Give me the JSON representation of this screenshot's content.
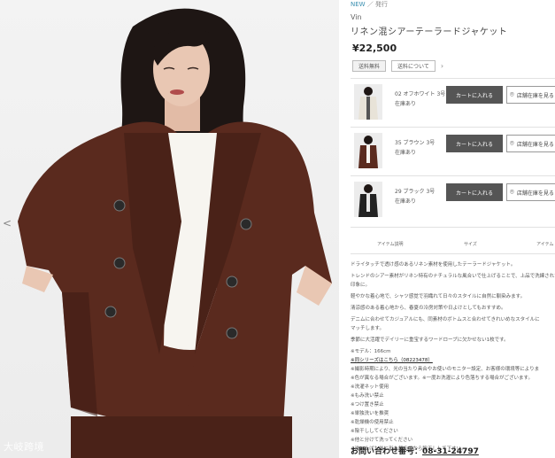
{
  "breadcrumb": {
    "new_label": "NEW",
    "rest": "／ 発行"
  },
  "product": {
    "brand": "Vin",
    "title": "リネン混シアーテーラードジャケット",
    "price": "¥22,500",
    "tags": [
      "送料無料",
      "送料について"
    ]
  },
  "variants": [
    {
      "color": "02 オフホワイト 3号",
      "stock": "在庫あり",
      "cart_label": "カートに入れる",
      "store_label": "店舗在庫を見る"
    },
    {
      "color": "35 ブラウン 3号",
      "stock": "在庫あり",
      "cart_label": "カートに入れる",
      "store_label": "店舗在庫を見る"
    },
    {
      "color": "29 ブラック 3号",
      "stock": "在庫あり",
      "cart_label": "カートに入れる",
      "store_label": "店舗在庫を見る"
    }
  ],
  "tabs": [
    "アイテム説明",
    "サイズ",
    "アイテム"
  ],
  "description": [
    "ドライタッチで透け感のあるリネン素材を使用したテーラードジャケット。",
    "トレンドのシアー素材がリネン特有のナチュラルな風合いで仕上げることで、上品で洗練された",
    "印象に。",
    "軽やかな着心地で、シャツ感覚で羽織れて日々のスタイルに自然に馴染みます。",
    "清涼感のある着心地から、春夏の冷房対策や日よけとしてもおすすめ。",
    "デニムに合わせてカジュアルにも、同素材のボトムスと合わせてきれいめなスタイルに",
    "マッチします。",
    "季節に大活躍でデイリーに重宝するワードローブに欠かせない1枚です。",
    "※モデル：166cm",
    "※同シリーズはこちら（08223478）",
    "※撮影時期により、光の当たり具合やお使いのモニター設定、お客様の環境等によりま",
    "※色が異なる場合がございます。※一度お洗濯により色落ちする場合がございます。",
    "※洗濯ネット使用",
    "※もみ洗い禁止",
    "※つけ置き禁止",
    "※単独洗いを推奨",
    "※乾燥機の使用禁止",
    "※陰干ししてください",
    "※他と分けて洗ってください",
    "※洗い上げた後に形を整えてから陰干しして下さい。"
  ],
  "contact": {
    "label": "お問い合わせ番号：",
    "number": "08-31-24797"
  },
  "watermark": "大岐跨境",
  "colors": {
    "jacket": "#5a2a1e",
    "jacket_shadow": "#3f1c14",
    "inner": "#f7f5f0",
    "hair": "#1e1614",
    "skin": "#e9c7b3",
    "button_dark": "#555555",
    "new_blue": "#3a8fb0"
  },
  "icons": {
    "prev": "chevron-left-icon",
    "store": "location-pin-icon"
  }
}
